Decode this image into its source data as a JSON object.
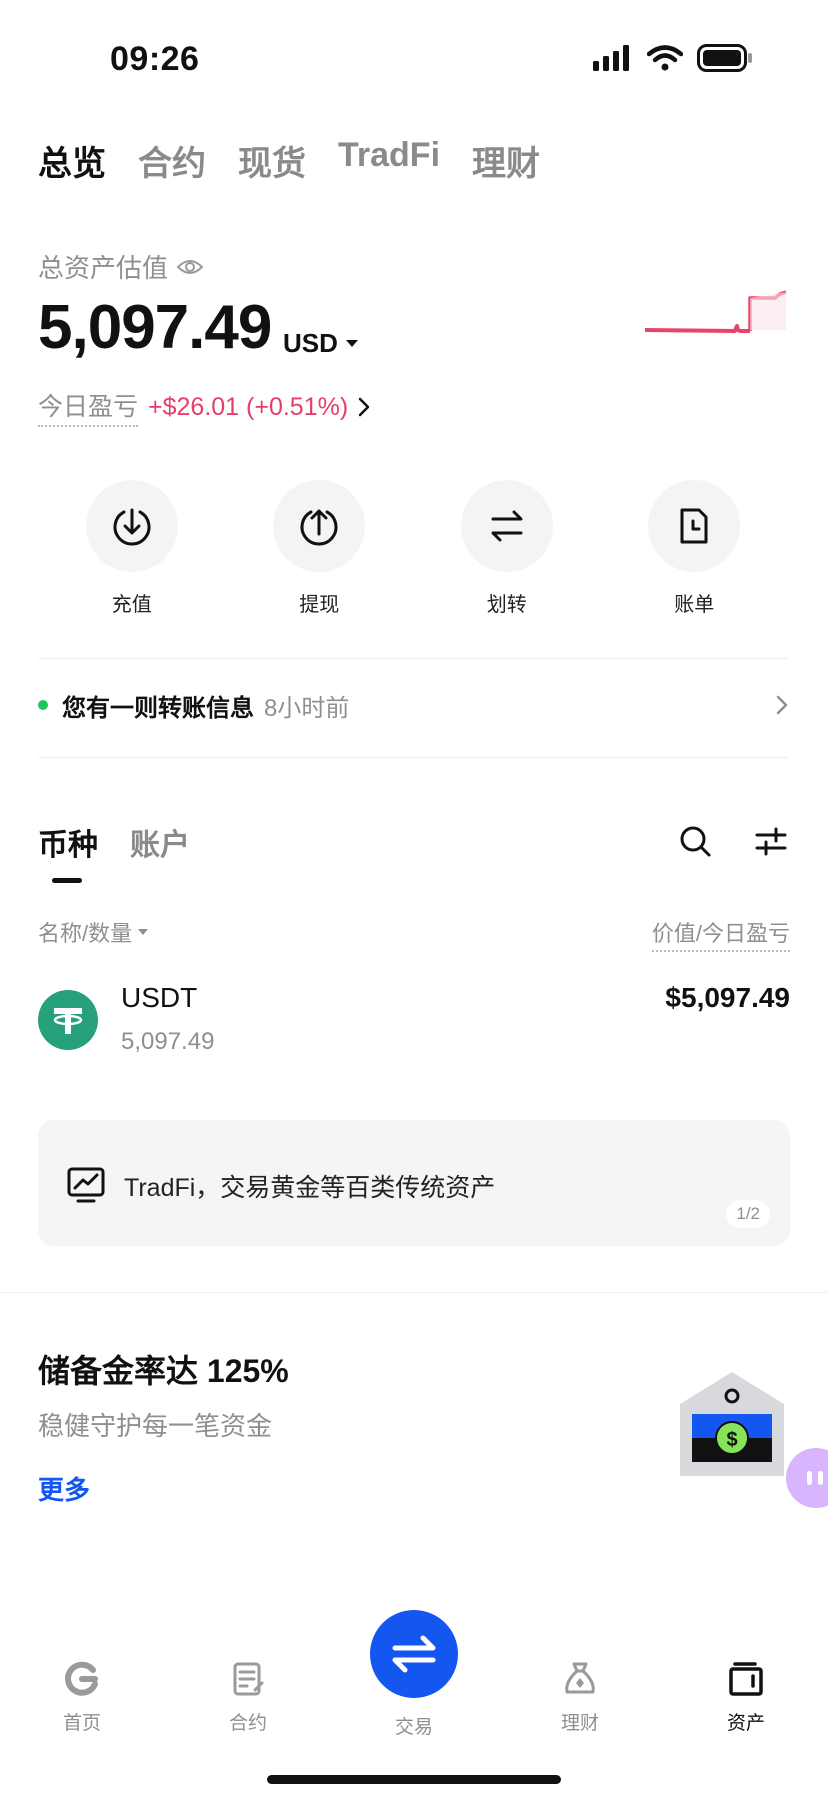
{
  "status_bar": {
    "time": "09:26"
  },
  "top_tabs": [
    "总览",
    "合约",
    "现货",
    "TradFi",
    "理财"
  ],
  "balance": {
    "label": "总资产估值",
    "value": "5,097.49",
    "currency": "USD",
    "pnl_label": "今日盈亏",
    "pnl_value": "+$26.01 (+0.51%)"
  },
  "actions": [
    {
      "label": "充值",
      "icon": "deposit-icon"
    },
    {
      "label": "提现",
      "icon": "withdraw-icon"
    },
    {
      "label": "划转",
      "icon": "transfer-icon"
    },
    {
      "label": "账单",
      "icon": "bill-icon"
    }
  ],
  "notice": {
    "text": "您有一则转账信息",
    "time": "8小时前"
  },
  "sub_tabs": [
    "币种",
    "账户"
  ],
  "columns": {
    "left": "名称/数量",
    "right": "价值/今日盈亏"
  },
  "assets": [
    {
      "symbol": "USDT",
      "amount": "5,097.49",
      "value": "$5,097.49"
    }
  ],
  "promo": {
    "text": "TradFi，交易黄金等百类传统资产",
    "page": "1/2"
  },
  "reserve": {
    "title": "储备金率达 125%",
    "subtitle": "稳健守护每一笔资金",
    "more": "更多"
  },
  "bottom_nav": {
    "items": [
      "首页",
      "合约",
      "交易",
      "理财",
      "资产"
    ],
    "active": "资产"
  },
  "colors": {
    "accent": "#1456f0",
    "negative": "#e53e6b",
    "usdt": "#26a17b",
    "notice_dot": "#1ec35a"
  }
}
